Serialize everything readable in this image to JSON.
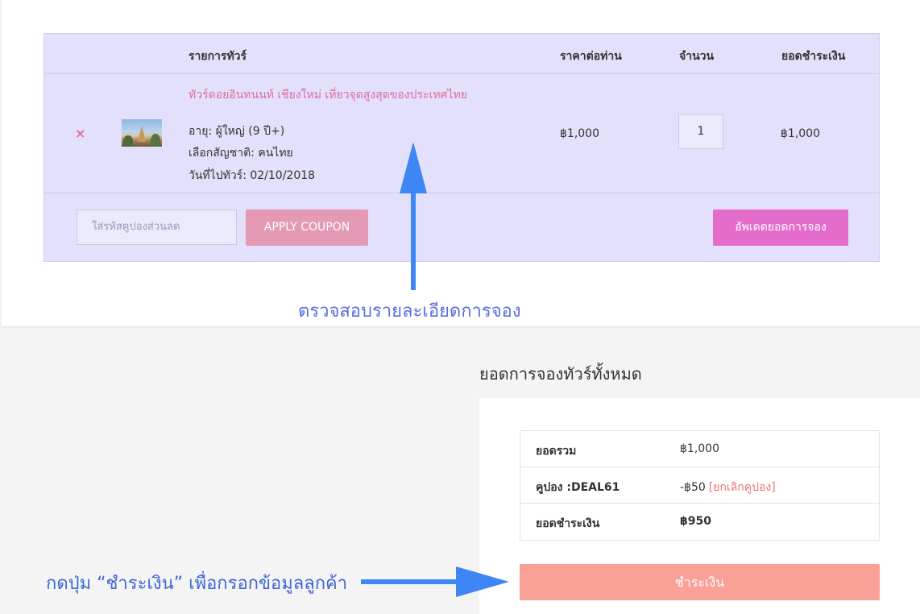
{
  "cart": {
    "headers": {
      "product": "รายการทัวร์",
      "price": "ราคาต่อท่าน",
      "quantity": "จำนวน",
      "subtotal": "ยอดชำระเงิน"
    },
    "item": {
      "remove_icon": "×",
      "name": "ทัวร์ดอยอินทนนท์ เชียงใหม่ เที่ยวจุดสูงสุดของประเทศไทย",
      "meta": [
        "อายุ: ผู้ใหญ่ (9 ปี+)",
        "เลือกสัญชาติ: คนไทย",
        "วันที่ไปทัวร์: 02/10/2018"
      ],
      "price": "฿1,000",
      "quantity": "1",
      "subtotal": "฿1,000"
    },
    "coupon_placeholder": "ใส่รหัสคูปองส่วนลด",
    "apply_coupon_label": "APPLY COUPON",
    "update_cart_label": "อัพเดตยอดการจอง"
  },
  "annotations": {
    "review_caption": "ตรวจสอบรายละเอียดการจอง",
    "pay_caption": "กดปุ่ม “ชำระเงิน” เพื่อกรอกข้อมูลลูกค้า",
    "arrow_color": "#3e86f3"
  },
  "totals": {
    "title": "ยอดการจองทัวร์ทั้งหมด",
    "rows": [
      {
        "label": "ยอดรวม",
        "value": "฿1,000"
      },
      {
        "label": "คูปอง :DEAL61",
        "value": "-฿50",
        "action": "[ยกเลิกคูปอง]"
      },
      {
        "label": "ยอดชำระเงิน",
        "value": "฿950"
      }
    ],
    "checkout_label": "ชำระเงิน"
  },
  "colors": {
    "cart_bg": "#e2e0fb",
    "accent_pink": "#e06b9c",
    "apply_btn": "#e49ab5",
    "update_btn": "#e46ccb",
    "checkout_btn": "#f9a097"
  }
}
